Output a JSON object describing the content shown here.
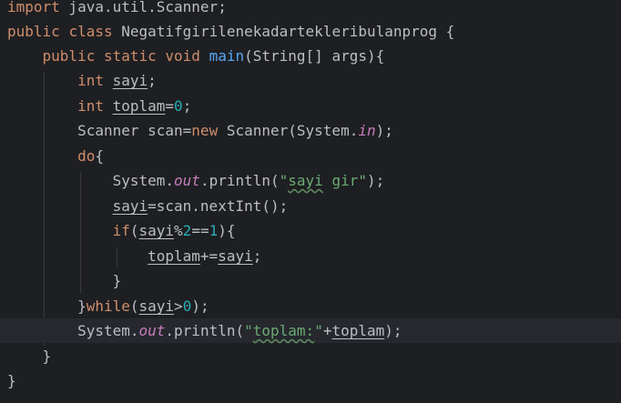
{
  "code": {
    "l1": {
      "kw": "import",
      "rest": " java.util.Scanner;"
    },
    "l2": {
      "kw1": "public",
      "kw2": "class",
      "name": "Negatifgirilenekadartekleribulanprog",
      "brace": " {"
    },
    "l3": {
      "kw1": "public",
      "kw2": "static",
      "kw3": "void",
      "fn": "main",
      "params": "(String[] args){"
    },
    "l4": {
      "kw": "int",
      "var": "sayi",
      "end": ";"
    },
    "l5": {
      "kw": "int",
      "var": "toplam",
      "eq": "=",
      "num": "0",
      "end": ";"
    },
    "l6": {
      "a": "Scanner scan=",
      "kw": "new",
      "b": " Scanner(System.",
      "fld": "in",
      "c": ");"
    },
    "l7": {
      "kw": "do",
      "brace": "{"
    },
    "l8": {
      "a": "System.",
      "fld": "out",
      "b": ".println(",
      "q1": "\"",
      "typo": "sayi",
      "str": " gir\"",
      "c": ");"
    },
    "l9": {
      "var": "sayi",
      "rest": "=scan.nextInt();"
    },
    "l10": {
      "kw": "if",
      "p": "(",
      "var": "sayi",
      "op": "%",
      "n1": "2",
      "eq": "==",
      "n2": "1",
      "end": "){"
    },
    "l11": {
      "var1": "toplam",
      "op": "+=",
      "var2": "sayi",
      "end": ";"
    },
    "l12": {
      "brace": "}"
    },
    "l13": {
      "brace": "}",
      "kw": "while",
      "p": "(",
      "var": "sayi",
      "op": ">",
      "num": "0",
      "end": ");"
    },
    "l14": {
      "a": "System.",
      "fld": "out",
      "b": ".println(",
      "q1": "\"",
      "typo": "toplam:",
      "q2": "\"",
      "plus": "+",
      "var": "toplam",
      "c": ");"
    },
    "l15": {
      "brace": "}"
    },
    "l16": {
      "brace": "}"
    }
  }
}
